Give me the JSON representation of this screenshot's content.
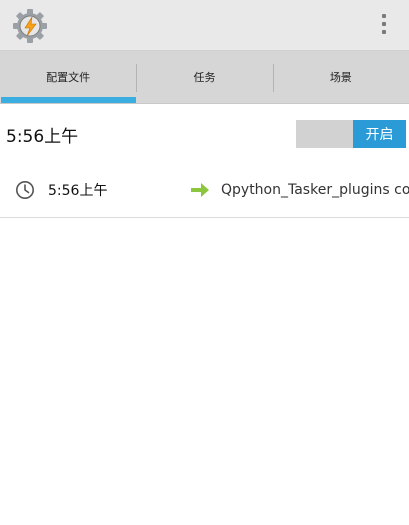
{
  "actionbar": {
    "app_icon": "tasker-gear-lightning-icon",
    "overflow_icon": "vertical-dots-icon"
  },
  "tabs": [
    {
      "label": "配置文件",
      "active": true
    },
    {
      "label": "任务",
      "active": false
    },
    {
      "label": "场景",
      "active": false
    }
  ],
  "profile": {
    "name": "5:56上午",
    "toggle_label": "开启",
    "enabled": true,
    "context": {
      "icon": "clock-icon",
      "time": "5:56上午",
      "arrow_icon": "green-arrow-right-icon",
      "task": "Qpython_Tasker_plugins com"
    }
  },
  "colors": {
    "accent": "#3aaee0",
    "toggle_on": "#2b9bd8",
    "arrow": "#8cc63f"
  }
}
